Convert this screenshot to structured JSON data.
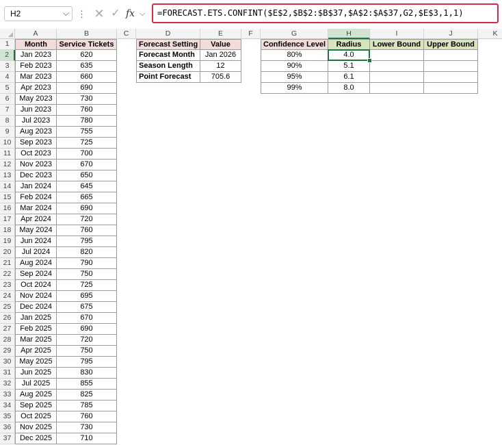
{
  "formula_bar": {
    "name_box": "H2",
    "formula": "=FORECAST.ETS.CONFINT($E$2,$B$2:$B$37,$A$2:$A$37,G2,$E$3,1,1)"
  },
  "columns": [
    "A",
    "B",
    "C",
    "D",
    "E",
    "F",
    "G",
    "H",
    "I",
    "J",
    "K"
  ],
  "selected_cell": "H2",
  "table_main": {
    "headers": [
      "Month",
      "Service Tickets"
    ],
    "rows": [
      [
        "Jan 2023",
        "620"
      ],
      [
        "Feb 2023",
        "635"
      ],
      [
        "Mar 2023",
        "660"
      ],
      [
        "Apr 2023",
        "690"
      ],
      [
        "May 2023",
        "730"
      ],
      [
        "Jun 2023",
        "760"
      ],
      [
        "Jul 2023",
        "780"
      ],
      [
        "Aug 2023",
        "755"
      ],
      [
        "Sep 2023",
        "725"
      ],
      [
        "Oct 2023",
        "700"
      ],
      [
        "Nov 2023",
        "670"
      ],
      [
        "Dec 2023",
        "650"
      ],
      [
        "Jan 2024",
        "645"
      ],
      [
        "Feb 2024",
        "665"
      ],
      [
        "Mar 2024",
        "690"
      ],
      [
        "Apr 2024",
        "720"
      ],
      [
        "May 2024",
        "760"
      ],
      [
        "Jun 2024",
        "795"
      ],
      [
        "Jul 2024",
        "820"
      ],
      [
        "Aug 2024",
        "790"
      ],
      [
        "Sep 2024",
        "750"
      ],
      [
        "Oct 2024",
        "725"
      ],
      [
        "Nov 2024",
        "695"
      ],
      [
        "Dec 2024",
        "675"
      ],
      [
        "Jan 2025",
        "670"
      ],
      [
        "Feb 2025",
        "690"
      ],
      [
        "Mar 2025",
        "720"
      ],
      [
        "Apr 2025",
        "750"
      ],
      [
        "May 2025",
        "795"
      ],
      [
        "Jun 2025",
        "830"
      ],
      [
        "Jul 2025",
        "855"
      ],
      [
        "Aug 2025",
        "825"
      ],
      [
        "Sep 2025",
        "785"
      ],
      [
        "Oct 2025",
        "760"
      ],
      [
        "Nov 2025",
        "730"
      ],
      [
        "Dec 2025",
        "710"
      ]
    ]
  },
  "table_settings": {
    "headers": [
      "Forecast Setting",
      "Value"
    ],
    "rows": [
      [
        "Forecast Month",
        "Jan 2026"
      ],
      [
        "Season Length",
        "12"
      ],
      [
        "Point Forecast",
        "705.6"
      ]
    ]
  },
  "table_confint": {
    "headers": [
      "Confidence Level",
      "Radius",
      "Lower Bound",
      "Upper Bound"
    ],
    "rows": [
      [
        "80%",
        "4.0",
        "",
        ""
      ],
      [
        "90%",
        "5.1",
        "",
        ""
      ],
      [
        "95%",
        "6.1",
        "",
        ""
      ],
      [
        "99%",
        "8.0",
        "",
        ""
      ]
    ]
  },
  "colors": {
    "header_pink": "#f2dcdb",
    "header_green": "#d8e4bc",
    "selection_green": "#217346",
    "formula_border": "#d42a4a"
  }
}
